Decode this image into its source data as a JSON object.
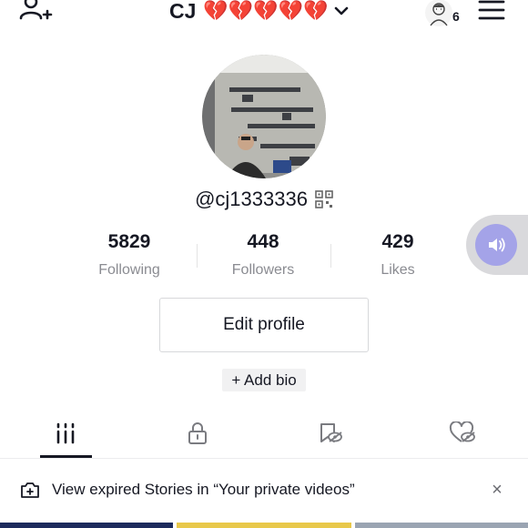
{
  "header": {
    "name": "CJ",
    "hearts": "💔💔💔💔💔",
    "notification_count": "6",
    "icons": {
      "add_user": "person-add-icon",
      "dropdown": "chevron-down-icon",
      "menu": "hamburger-menu-icon"
    }
  },
  "profile": {
    "username": "@cj1333336",
    "qr_icon": "qr-code-icon"
  },
  "stats": [
    {
      "value": "5829",
      "label": "Following"
    },
    {
      "value": "448",
      "label": "Followers"
    },
    {
      "value": "429",
      "label": "Likes"
    }
  ],
  "actions": {
    "edit_profile": "Edit profile",
    "add_bio": "+ Add bio"
  },
  "tabs": [
    {
      "name": "videos-grid",
      "icon": "grid-bars-icon",
      "active": true
    },
    {
      "name": "private",
      "icon": "lock-icon",
      "active": false
    },
    {
      "name": "favorites",
      "icon": "bookmark-hidden-icon",
      "active": false
    },
    {
      "name": "liked",
      "icon": "heart-hidden-icon",
      "active": false
    }
  ],
  "banner": {
    "text": "View expired Stories in “Your private videos”",
    "close": "×"
  },
  "colors": {
    "text": "#161823",
    "muted": "#8a8b91",
    "heart": "#d8222b",
    "float_button": "#a4a3e8"
  }
}
